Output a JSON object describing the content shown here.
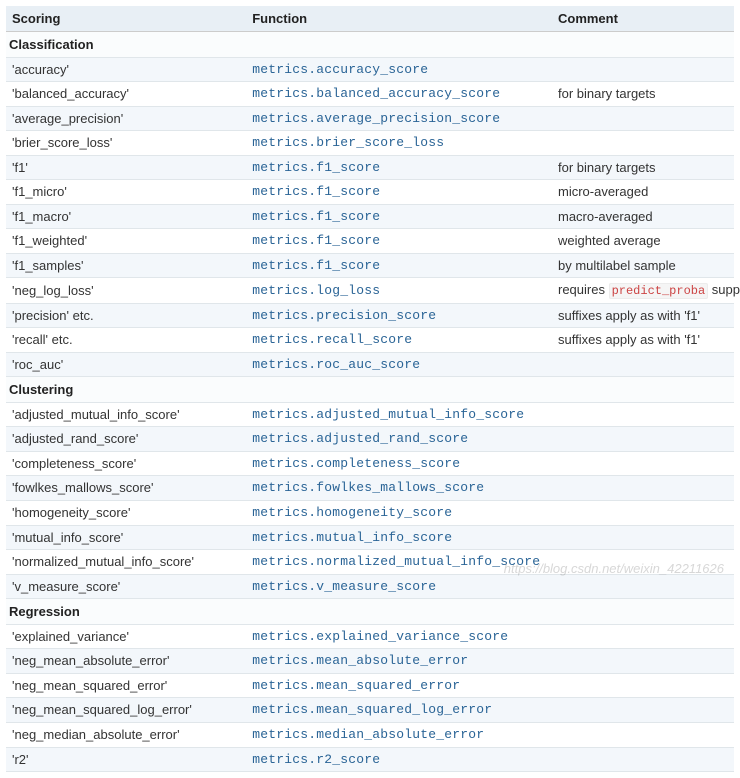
{
  "columns": {
    "scoring": "Scoring",
    "function": "Function",
    "comment": "Comment"
  },
  "column_widths": [
    "33%",
    "42%",
    "25%"
  ],
  "sections": [
    {
      "title": "Classification",
      "rows": [
        {
          "scoring": "'accuracy'",
          "function": "metrics.accuracy_score",
          "comment": ""
        },
        {
          "scoring": "'balanced_accuracy'",
          "function": "metrics.balanced_accuracy_score",
          "comment": "for binary targets"
        },
        {
          "scoring": "'average_precision'",
          "function": "metrics.average_precision_score",
          "comment": ""
        },
        {
          "scoring": "'brier_score_loss'",
          "function": "metrics.brier_score_loss",
          "comment": ""
        },
        {
          "scoring": "'f1'",
          "function": "metrics.f1_score",
          "comment": "for binary targets"
        },
        {
          "scoring": "'f1_micro'",
          "function": "metrics.f1_score",
          "comment": "micro-averaged"
        },
        {
          "scoring": "'f1_macro'",
          "function": "metrics.f1_score",
          "comment": "macro-averaged"
        },
        {
          "scoring": "'f1_weighted'",
          "function": "metrics.f1_score",
          "comment": "weighted average"
        },
        {
          "scoring": "'f1_samples'",
          "function": "metrics.f1_score",
          "comment": "by multilabel sample"
        },
        {
          "scoring": "'neg_log_loss'",
          "function": "metrics.log_loss",
          "comment_pre": "requires ",
          "comment_code": "predict_proba",
          "comment_post": " support"
        },
        {
          "scoring": "'precision' etc.",
          "function": "metrics.precision_score",
          "comment": "suffixes apply as with 'f1'"
        },
        {
          "scoring": "'recall' etc.",
          "function": "metrics.recall_score",
          "comment": "suffixes apply as with 'f1'"
        },
        {
          "scoring": "'roc_auc'",
          "function": "metrics.roc_auc_score",
          "comment": ""
        }
      ]
    },
    {
      "title": "Clustering",
      "rows": [
        {
          "scoring": "'adjusted_mutual_info_score'",
          "function": "metrics.adjusted_mutual_info_score",
          "comment": ""
        },
        {
          "scoring": "'adjusted_rand_score'",
          "function": "metrics.adjusted_rand_score",
          "comment": ""
        },
        {
          "scoring": "'completeness_score'",
          "function": "metrics.completeness_score",
          "comment": ""
        },
        {
          "scoring": "'fowlkes_mallows_score'",
          "function": "metrics.fowlkes_mallows_score",
          "comment": ""
        },
        {
          "scoring": "'homogeneity_score'",
          "function": "metrics.homogeneity_score",
          "comment": ""
        },
        {
          "scoring": "'mutual_info_score'",
          "function": "metrics.mutual_info_score",
          "comment": ""
        },
        {
          "scoring": "'normalized_mutual_info_score'",
          "function": "metrics.normalized_mutual_info_score",
          "comment": ""
        },
        {
          "scoring": "'v_measure_score'",
          "function": "metrics.v_measure_score",
          "comment": ""
        }
      ]
    },
    {
      "title": "Regression",
      "rows": [
        {
          "scoring": "'explained_variance'",
          "function": "metrics.explained_variance_score",
          "comment": ""
        },
        {
          "scoring": "'neg_mean_absolute_error'",
          "function": "metrics.mean_absolute_error",
          "comment": ""
        },
        {
          "scoring": "'neg_mean_squared_error'",
          "function": "metrics.mean_squared_error",
          "comment": ""
        },
        {
          "scoring": "'neg_mean_squared_log_error'",
          "function": "metrics.mean_squared_log_error",
          "comment": ""
        },
        {
          "scoring": "'neg_median_absolute_error'",
          "function": "metrics.median_absolute_error",
          "comment": ""
        },
        {
          "scoring": "'r2'",
          "function": "metrics.r2_score",
          "comment": ""
        }
      ]
    }
  ],
  "watermark": "https://blog.csdn.net/weixin_42211626"
}
